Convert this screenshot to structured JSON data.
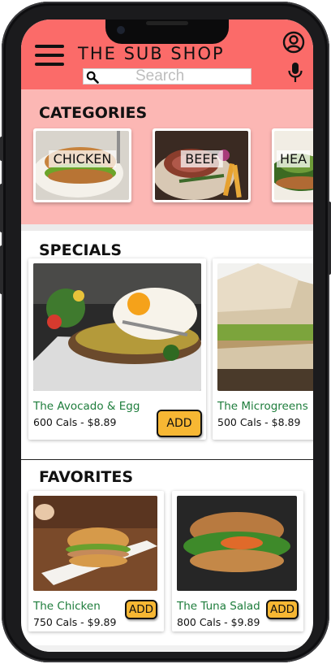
{
  "header": {
    "title": "THE SUB SHOP",
    "search_placeholder": "Search",
    "menu_icon": "hamburger-menu-icon",
    "profile_icon": "user-circle-icon",
    "mic_icon": "microphone-icon",
    "search_icon": "magnifier-icon",
    "bg_color": "#fb6b69"
  },
  "categories": {
    "title": "CATEGORIES",
    "bg_color": "#fcb7b4",
    "items": [
      {
        "label": "CHICKEN"
      },
      {
        "label": "BEEF"
      },
      {
        "label": "HEA"
      }
    ]
  },
  "specials": {
    "title": "SPECIALS",
    "items": [
      {
        "name": "The Avocado & Egg",
        "meta": "600 Cals - $8.89",
        "add_label": "ADD"
      },
      {
        "name": "The Microgreens",
        "meta": "500 Cals - $8.89"
      }
    ]
  },
  "favorites": {
    "title": "FAVORITES",
    "items": [
      {
        "name": "The Chicken",
        "meta": "750 Cals - $9.89",
        "add_label": "ADD"
      },
      {
        "name": "The Tuna Salad",
        "meta": "800 Cals - $9.89",
        "add_label": "ADD"
      }
    ]
  },
  "colors": {
    "accent_green": "#1e7d3c",
    "add_button": "#f7b733"
  }
}
